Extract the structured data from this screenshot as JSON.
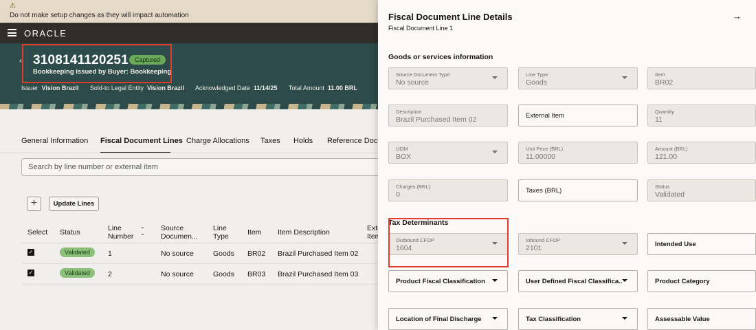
{
  "warning": {
    "icon": "warning-icon",
    "text": "Do not make setup changes as they will impact automation"
  },
  "nav": {
    "logo": "ORACLE"
  },
  "header": {
    "doc_number": "3108141120251",
    "status": "Captured",
    "subtitle": "Bookkeeping issued by Buyer: Bookkeeping",
    "meta": [
      {
        "label": "Issuer",
        "value": "Vision Brazil"
      },
      {
        "label": "Sold-to Legal Entity",
        "value": "Vision Brazil"
      },
      {
        "label": "Acknowledged Date",
        "value": "11/14/25"
      },
      {
        "label": "Total Amount",
        "value": "11.00 BRL"
      }
    ]
  },
  "tabs": [
    "General Information",
    "Fiscal Document Lines",
    "Charge Allocations",
    "Taxes",
    "Holds",
    "Reference Docu"
  ],
  "search": {
    "placeholder": "Search by line number or external item"
  },
  "actions": {
    "update_lines": "Update Lines",
    "add": "+"
  },
  "table": {
    "headers": {
      "select": "Select",
      "status": "Status",
      "line_number": "Line Number",
      "source_doc": "Source Documen...",
      "line_type": "Line Type",
      "item": "Item",
      "item_desc": "Item Description",
      "ext": "Exte Item"
    },
    "rows": [
      {
        "status": "Validated",
        "line": "1",
        "source": "No source",
        "type": "Goods",
        "item": "BR02",
        "desc": "Brazil Purchased Item 02"
      },
      {
        "status": "Validated",
        "line": "2",
        "source": "No source",
        "type": "Goods",
        "item": "BR03",
        "desc": "Brazil Purchased Item 03"
      }
    ]
  },
  "drawer": {
    "title": "Fiscal Document Line Details",
    "subtitle": "Fiscal Document Line 1",
    "section_goods": "Goods or services information",
    "section_tax": "Tax Determinants",
    "fields": {
      "source_doc_type": {
        "label": "Source Document Type",
        "value": "No source"
      },
      "line_type": {
        "label": "Line Type",
        "value": "Goods"
      },
      "item": {
        "label": "Item",
        "value": "BR02"
      },
      "description": {
        "label": "Description",
        "value": "Brazil Purchased Item 02"
      },
      "external_item": {
        "label": "External Item"
      },
      "quantity": {
        "label": "Quantity",
        "value": "11"
      },
      "uom": {
        "label": "UOM",
        "value": "BOX"
      },
      "unit_price": {
        "label": "Unit Price (BRL)",
        "value": "11.00000"
      },
      "amount": {
        "label": "Amount (BRL)",
        "value": "121.00"
      },
      "charges": {
        "label": "Charges (BRL)",
        "value": "0"
      },
      "taxes": {
        "label": "Taxes (BRL)"
      },
      "status": {
        "label": "Status",
        "value": "Validated"
      },
      "outbound_cfop": {
        "label": "Outbound CFOP",
        "value": "1604"
      },
      "inbound_cfop": {
        "label": "Inbound CFOP",
        "value": "2101"
      },
      "intended_use": {
        "label": "Intended Use"
      },
      "product_fiscal_class": {
        "label": "Product Fiscal Classification"
      },
      "user_defined_fiscal_class": {
        "label": "User Defined Fiscal Classifica..."
      },
      "product_category": {
        "label": "Product Category"
      },
      "location_final_discharge": {
        "label": "Location of Final Discharge"
      },
      "tax_classification": {
        "label": "Tax Classification"
      },
      "assessable_value": {
        "label": "Assessable Value"
      }
    }
  },
  "colors": {
    "header_bg": "#2c4b4a",
    "nav_bg": "#312d2a",
    "warning_bg": "#e5d9c8",
    "highlight": "#e33a2c",
    "badge_green": "#8cc07a"
  }
}
